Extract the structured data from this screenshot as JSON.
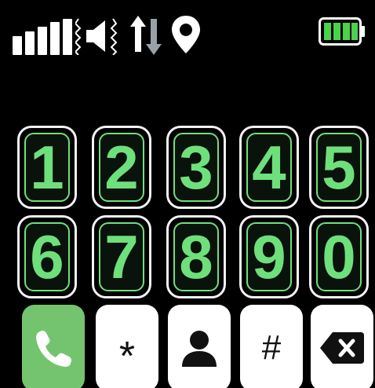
{
  "status_bar": {
    "icons": [
      "signal-strength-icon",
      "speaker-vibrate-icon",
      "data-transfer-icon",
      "location-pin-icon",
      "battery-full-icon"
    ],
    "colors": {
      "icon": "#ffffff",
      "battery_fill": "#4bd14b"
    }
  },
  "keypad": {
    "row1": [
      {
        "label": "1"
      },
      {
        "label": "2"
      },
      {
        "label": "3"
      },
      {
        "label": "4"
      },
      {
        "label": "5"
      }
    ],
    "row2": [
      {
        "label": "6"
      },
      {
        "label": "7"
      },
      {
        "label": "8"
      },
      {
        "label": "9"
      },
      {
        "label": "0"
      }
    ],
    "colors": {
      "digit": "#6ee07b",
      "key_border": "#f2f2f2",
      "background": "#000000"
    }
  },
  "actions": {
    "call": {
      "icon": "phone-icon",
      "color": "#74c46f"
    },
    "star": {
      "label": "*"
    },
    "contacts": {
      "icon": "contacts-person-icon"
    },
    "hash": {
      "label": "#"
    },
    "backspace": {
      "icon": "backspace-icon"
    }
  }
}
